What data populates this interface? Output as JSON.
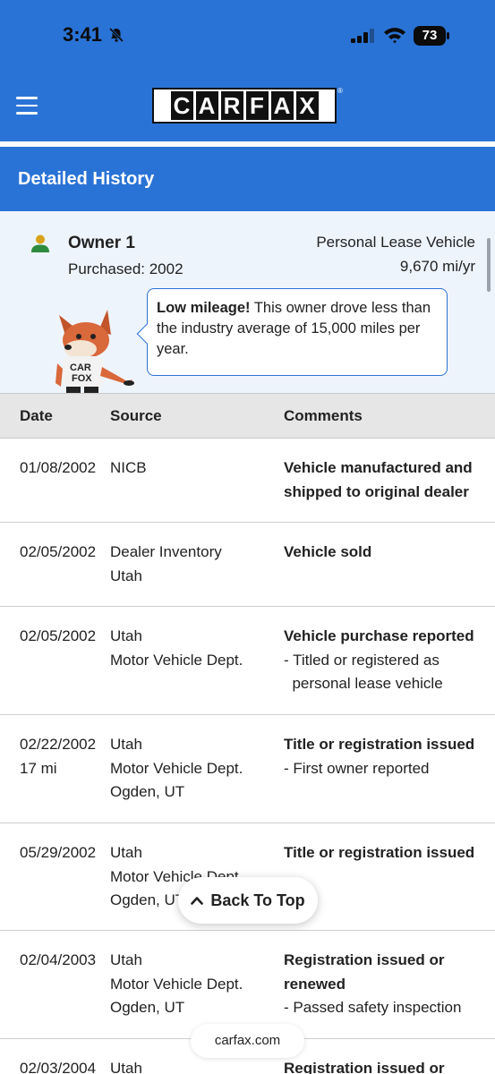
{
  "status_bar": {
    "time": "3:41",
    "battery": "73"
  },
  "header": {
    "logo_letters": [
      "C",
      "A",
      "R",
      "F",
      "A",
      "X"
    ],
    "logo_registered": "®"
  },
  "section": {
    "title": "Detailed History"
  },
  "owner": {
    "name": "Owner 1",
    "purchased": "Purchased: 2002",
    "type": "Personal Lease Vehicle",
    "mileage": "9,670 mi/yr",
    "tip_bold": "Low mileage!",
    "tip_text": " This owner drove less than the industry average of 15,000 miles per year."
  },
  "table": {
    "headers": {
      "date": "Date",
      "source": "Source",
      "comments": "Comments"
    },
    "rows": [
      {
        "date": "01/08/2002",
        "mileage": "",
        "source": [
          "NICB"
        ],
        "title": "Vehicle manufactured and shipped to original dealer",
        "notes": []
      },
      {
        "date": "02/05/2002",
        "mileage": "",
        "source": [
          "Dealer Inventory",
          "Utah"
        ],
        "title": "Vehicle sold",
        "notes": []
      },
      {
        "date": "02/05/2002",
        "mileage": "",
        "source": [
          "Utah",
          "Motor Vehicle Dept."
        ],
        "title": "Vehicle purchase reported",
        "notes": [
          "- Titled or registered as",
          "  personal lease vehicle"
        ]
      },
      {
        "date": "02/22/2002",
        "mileage": "17 mi",
        "source": [
          "Utah",
          "Motor Vehicle Dept.",
          "Ogden, UT"
        ],
        "title": "Title or registration issued",
        "notes": [
          "- First owner reported"
        ]
      },
      {
        "date": "05/29/2002",
        "mileage": "",
        "source": [
          "Utah",
          "Motor Vehicle Dept.",
          "Ogden, UT"
        ],
        "title": "Title or registration issued",
        "notes": []
      },
      {
        "date": "02/04/2003",
        "mileage": "",
        "source": [
          "Utah",
          "Motor Vehicle Dept.",
          "Ogden, UT"
        ],
        "title": "Registration issued or renewed",
        "notes": [
          "- Passed safety inspection"
        ]
      },
      {
        "date": "02/03/2004",
        "mileage": "",
        "source": [
          "Utah"
        ],
        "title": "Registration issued or",
        "notes": []
      }
    ]
  },
  "back_to_top": "Back To Top",
  "url": "carfax.com"
}
